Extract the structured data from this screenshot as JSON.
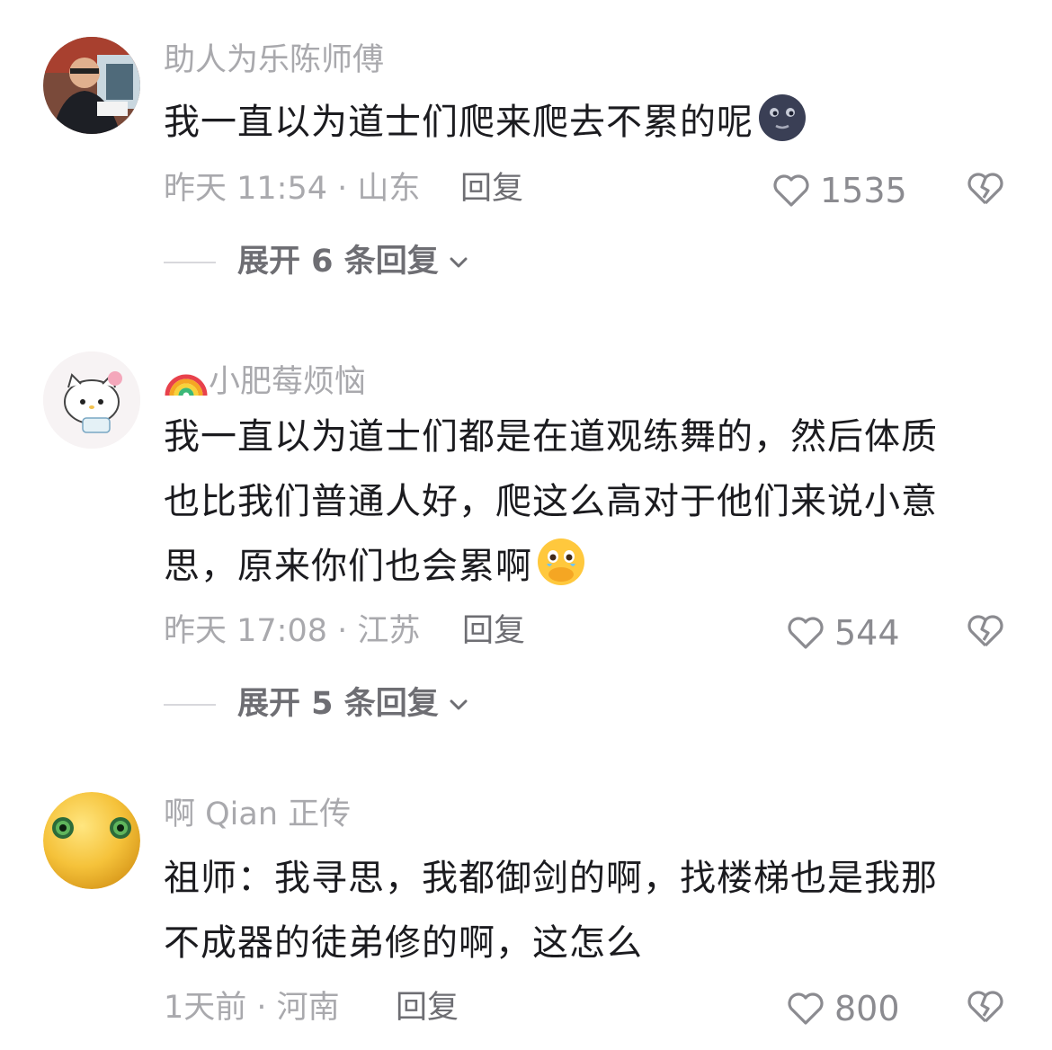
{
  "comments": [
    {
      "username": "助人为乐陈师傅",
      "lines": [
        "我一直以为道士们爬来爬去不累的呢"
      ],
      "emoji": "moon-face",
      "time_location": "昨天 11:54 · 山东",
      "reply_label": "回复",
      "likes": "1535",
      "expand_label": "展开 6 条回复"
    },
    {
      "username": "小肥莓烦恼",
      "username_prefix_emoji": "rainbow",
      "lines": [
        "我一直以为道士们都是在道观练舞的，然后体质",
        "也比我们普通人好，爬这么高对于他们来说小意",
        "思，原来你们也会累啊"
      ],
      "emoji": "holding-back-tears",
      "time_location": "昨天 17:08 · 江苏",
      "reply_label": "回复",
      "likes": "544",
      "expand_label": "展开 5 条回复"
    },
    {
      "username": "啊 Qian 正传",
      "lines": [
        "祖师：我寻思，我都御剑的啊，找楼梯也是我那",
        "不成器的徒弟修的啊，这怎么"
      ],
      "time_location": "1天前 · 河南",
      "reply_label": "回复",
      "likes": "800"
    }
  ],
  "icons": {
    "like": "heart-outline-icon",
    "dislike": "broken-heart-outline-icon",
    "expand": "chevron-down-icon"
  },
  "colors": {
    "primary_text": "#1b1b1f",
    "secondary_text": "#a9a9ad",
    "action_text": "#6e6e73"
  }
}
